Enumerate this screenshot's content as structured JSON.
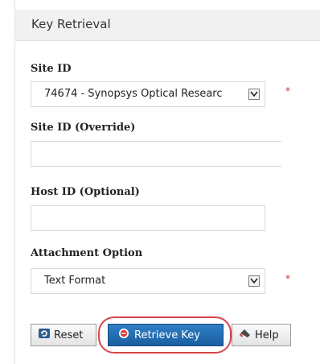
{
  "panel": {
    "title": "Key Retrieval"
  },
  "fields": {
    "site_id": {
      "label": "Site ID",
      "value": "74674 - Synopsys Optical Researc",
      "required_marker": "*"
    },
    "site_id_override": {
      "label": "Site ID (Override)",
      "value": ""
    },
    "host_id": {
      "label": "Host ID (Optional)",
      "value": ""
    },
    "attachment_option": {
      "label": "Attachment Option",
      "value": "Text Format",
      "required_marker": "*"
    }
  },
  "buttons": {
    "reset": {
      "label": "Reset",
      "icon": "reset-icon"
    },
    "retrieve_key": {
      "label": "Retrieve Key",
      "icon": "retrieve-key-icon"
    },
    "help": {
      "label": "Help",
      "icon": "help-icon"
    }
  },
  "colors": {
    "primary_button": "#1b5fa0",
    "required_marker": "#d0302b",
    "highlight_ring": "#d8454a"
  }
}
